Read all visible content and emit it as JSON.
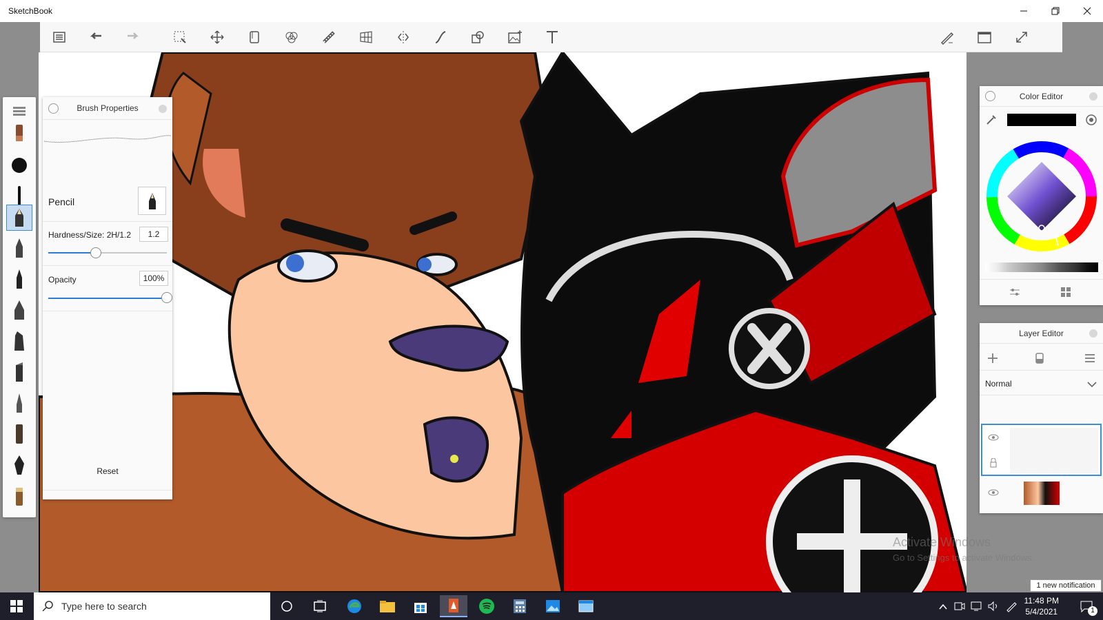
{
  "app": {
    "title": "SketchBook"
  },
  "colors": {
    "accent": "#2e7bd6",
    "taskbar": "#1f1f2b",
    "current_color": "#000000"
  },
  "toolbar": {
    "items": [
      "list-icon",
      "undo-icon",
      "redo-icon",
      "select-icon",
      "move-icon",
      "crop-icon",
      "color-mix-icon",
      "ruler-icon",
      "perspective-icon",
      "symmetry-icon",
      "curve-icon",
      "shape-icon",
      "image-import-icon",
      "text-icon"
    ],
    "right_items": [
      "brush-edit-icon",
      "window-icon",
      "fullscreen-icon"
    ]
  },
  "brush_panel": {
    "title": "Brush Properties",
    "brush_name": "Pencil",
    "hardness_label": "Hardness/Size: 2H/1.2",
    "hardness_value": "1.2",
    "hardness_fraction": 0.4,
    "opacity_label": "Opacity",
    "opacity_value": "100%",
    "opacity_fraction": 1.0,
    "reset_label": "Reset"
  },
  "color_panel": {
    "title": "Color Editor"
  },
  "layer_panel": {
    "title": "Layer Editor",
    "blend_mode": "Normal"
  },
  "taskbar": {
    "search_placeholder": "Type here to search",
    "time": "11:48 PM",
    "date": "5/4/2021",
    "notification": "1 new notification",
    "notification_count": "1"
  },
  "watermark": {
    "line1": "Activate Windows",
    "line2": "Go to Settings to activate Windows."
  }
}
